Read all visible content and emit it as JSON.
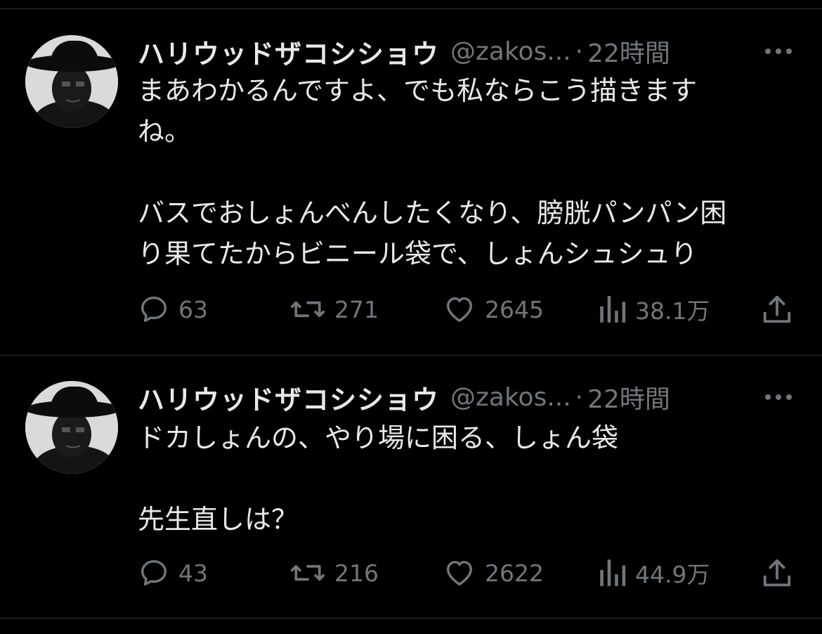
{
  "tweets": [
    {
      "display_name": "ハリウッドザコシショウ",
      "handle": "@zakos...",
      "separator": "·",
      "time": "22時間",
      "text_lines": [
        "まあわかるんですよ、でも私ならこう描きます",
        "ね。",
        "",
        "バスでおしょんべんしたくなり、膀胱パンパン困",
        "り果てたからビニール袋で、しょんシュシュり"
      ],
      "replies": "63",
      "retweets": "271",
      "likes": "2645",
      "views": "38.1万"
    },
    {
      "display_name": "ハリウッドザコシショウ",
      "handle": "@zakos...",
      "separator": "·",
      "time": "22時間",
      "text_lines": [
        "ドカしょんの、やり場に困る、しょん袋",
        "",
        "先生直しは？"
      ],
      "replies": "43",
      "retweets": "216",
      "likes": "2622",
      "views": "44.9万"
    }
  ],
  "colors": {
    "background": "#000000",
    "primary_text": "#e7e9ea",
    "secondary_text": "#71767b",
    "divider": "#2f3336"
  }
}
